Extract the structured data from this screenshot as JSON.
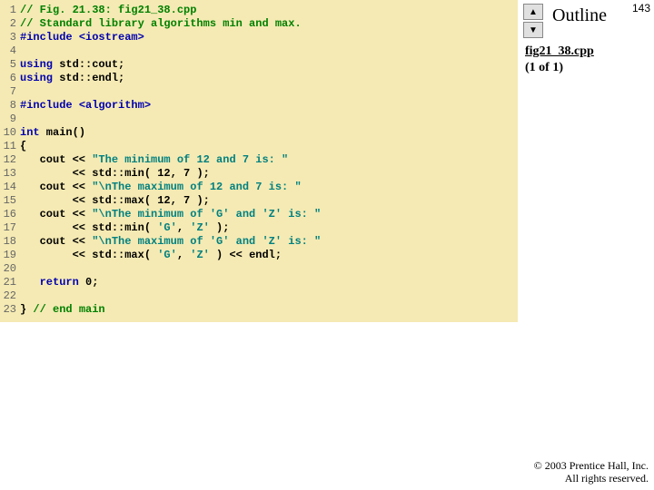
{
  "slide_number": "143",
  "outline": "Outline",
  "file": {
    "name": "fig21_38.cpp",
    "part": "(1 of 1)"
  },
  "nav": {
    "up_icon": "▲",
    "down_icon": "▼"
  },
  "copyright": {
    "line1": "© 2003 Prentice Hall, Inc.",
    "line2": "All rights reserved."
  },
  "code": [
    {
      "n": "1",
      "segs": [
        {
          "cls": "c-comment",
          "t": "// Fig. 21.38: fig21_38.cpp"
        }
      ]
    },
    {
      "n": "2",
      "segs": [
        {
          "cls": "c-comment",
          "t": "// Standard library algorithms min and max."
        }
      ]
    },
    {
      "n": "3",
      "segs": [
        {
          "cls": "c-pre",
          "t": "#include "
        },
        {
          "cls": "c-pre",
          "t": "<iostream>"
        }
      ]
    },
    {
      "n": "4",
      "segs": [
        {
          "cls": "c-plain",
          "t": ""
        }
      ]
    },
    {
      "n": "5",
      "segs": [
        {
          "cls": "c-kw",
          "t": "using"
        },
        {
          "cls": "c-plain",
          "t": " std::cout;"
        }
      ]
    },
    {
      "n": "6",
      "segs": [
        {
          "cls": "c-kw",
          "t": "using"
        },
        {
          "cls": "c-plain",
          "t": " std::endl;"
        }
      ]
    },
    {
      "n": "7",
      "segs": [
        {
          "cls": "c-plain",
          "t": ""
        }
      ]
    },
    {
      "n": "8",
      "segs": [
        {
          "cls": "c-pre",
          "t": "#include "
        },
        {
          "cls": "c-pre",
          "t": "<algorithm>"
        }
      ]
    },
    {
      "n": "9",
      "segs": [
        {
          "cls": "c-plain",
          "t": ""
        }
      ]
    },
    {
      "n": "10",
      "segs": [
        {
          "cls": "c-kw",
          "t": "int"
        },
        {
          "cls": "c-plain",
          "t": " main()"
        }
      ]
    },
    {
      "n": "11",
      "segs": [
        {
          "cls": "c-plain",
          "t": "{"
        }
      ]
    },
    {
      "n": "12",
      "segs": [
        {
          "cls": "c-plain",
          "t": "   cout << "
        },
        {
          "cls": "c-str",
          "t": "\"The minimum of 12 and 7 is: \""
        }
      ]
    },
    {
      "n": "13",
      "segs": [
        {
          "cls": "c-plain",
          "t": "        << std::min( "
        },
        {
          "cls": "c-plain",
          "t": "12"
        },
        {
          "cls": "c-plain",
          "t": ", "
        },
        {
          "cls": "c-plain",
          "t": "7"
        },
        {
          "cls": "c-plain",
          "t": " );"
        }
      ]
    },
    {
      "n": "14",
      "segs": [
        {
          "cls": "c-plain",
          "t": "   cout << "
        },
        {
          "cls": "c-str",
          "t": "\"\\nThe maximum of 12 and 7 is: \""
        }
      ]
    },
    {
      "n": "15",
      "segs": [
        {
          "cls": "c-plain",
          "t": "        << std::max( "
        },
        {
          "cls": "c-plain",
          "t": "12"
        },
        {
          "cls": "c-plain",
          "t": ", "
        },
        {
          "cls": "c-plain",
          "t": "7"
        },
        {
          "cls": "c-plain",
          "t": " );"
        }
      ]
    },
    {
      "n": "16",
      "segs": [
        {
          "cls": "c-plain",
          "t": "   cout << "
        },
        {
          "cls": "c-str",
          "t": "\"\\nThe minimum of 'G' and 'Z' is: \""
        }
      ]
    },
    {
      "n": "17",
      "segs": [
        {
          "cls": "c-plain",
          "t": "        << std::min( "
        },
        {
          "cls": "c-str",
          "t": "'G'"
        },
        {
          "cls": "c-plain",
          "t": ", "
        },
        {
          "cls": "c-str",
          "t": "'Z'"
        },
        {
          "cls": "c-plain",
          "t": " );"
        }
      ]
    },
    {
      "n": "18",
      "segs": [
        {
          "cls": "c-plain",
          "t": "   cout << "
        },
        {
          "cls": "c-str",
          "t": "\"\\nThe maximum of 'G' and 'Z' is: \""
        }
      ]
    },
    {
      "n": "19",
      "segs": [
        {
          "cls": "c-plain",
          "t": "        << std::max( "
        },
        {
          "cls": "c-str",
          "t": "'G'"
        },
        {
          "cls": "c-plain",
          "t": ", "
        },
        {
          "cls": "c-str",
          "t": "'Z'"
        },
        {
          "cls": "c-plain",
          "t": " ) << endl;"
        }
      ]
    },
    {
      "n": "20",
      "segs": [
        {
          "cls": "c-plain",
          "t": ""
        }
      ]
    },
    {
      "n": "21",
      "segs": [
        {
          "cls": "c-plain",
          "t": "   "
        },
        {
          "cls": "c-kw",
          "t": "return"
        },
        {
          "cls": "c-plain",
          "t": " "
        },
        {
          "cls": "c-plain",
          "t": "0"
        },
        {
          "cls": "c-plain",
          "t": ";"
        }
      ]
    },
    {
      "n": "22",
      "segs": [
        {
          "cls": "c-plain",
          "t": ""
        }
      ]
    },
    {
      "n": "23",
      "segs": [
        {
          "cls": "c-plain",
          "t": "} "
        },
        {
          "cls": "c-comment",
          "t": "// end main"
        }
      ]
    }
  ]
}
